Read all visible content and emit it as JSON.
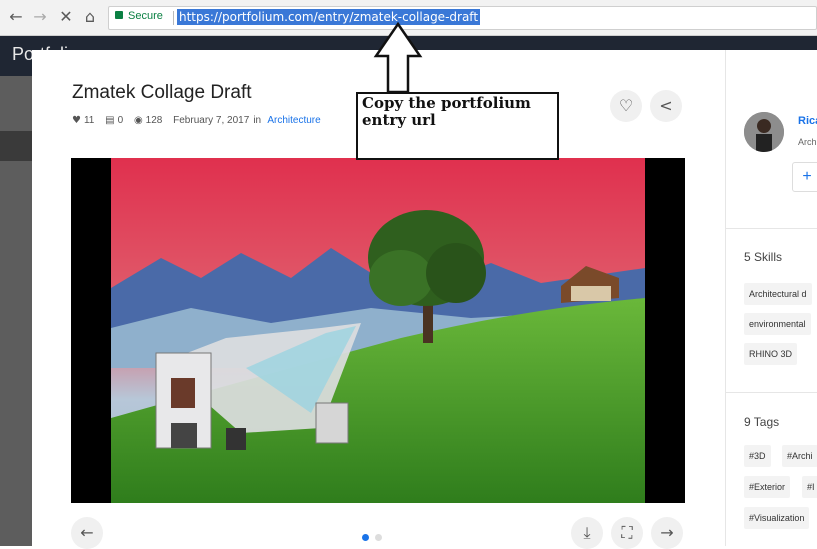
{
  "browser": {
    "secure_label": "Secure",
    "url": "https://portfolium.com/entry/zmatek-collage-draft",
    "back_glyph": "←",
    "forward_glyph": "→",
    "close_glyph": "✕",
    "home_glyph": "⌂"
  },
  "site": {
    "logo_text": "Portfolium"
  },
  "entry": {
    "title": "Zmatek Collage Draft",
    "likes": "11",
    "comments": "0",
    "views": "128",
    "date": "February 7, 2017",
    "in_label": "in",
    "category": "Architecture",
    "like_glyph": "♡",
    "share_glyph": "<",
    "prev_glyph": "←",
    "next_glyph": "→",
    "download_glyph": "⤓",
    "expand_glyph": "⛶"
  },
  "annotation": {
    "text": "Copy the portfolium entry url"
  },
  "sidebar": {
    "user_name": "Rica",
    "user_sub": "Arch",
    "follow_glyph": "+",
    "skills_title": "5 Skills",
    "skills": [
      "Architectural d",
      "environmental",
      "RHINO 3D"
    ],
    "tags_title": "9 Tags",
    "tags": [
      "#3D",
      "#Archi",
      "#Exterior",
      "#I",
      "#Visualization"
    ]
  },
  "carousel": {
    "active_index": 0,
    "count": 2
  },
  "colors": {
    "accent": "#1a73e8",
    "header": "#1f2633",
    "url_highlight": "#3a78d7",
    "secure": "#0b8043"
  }
}
